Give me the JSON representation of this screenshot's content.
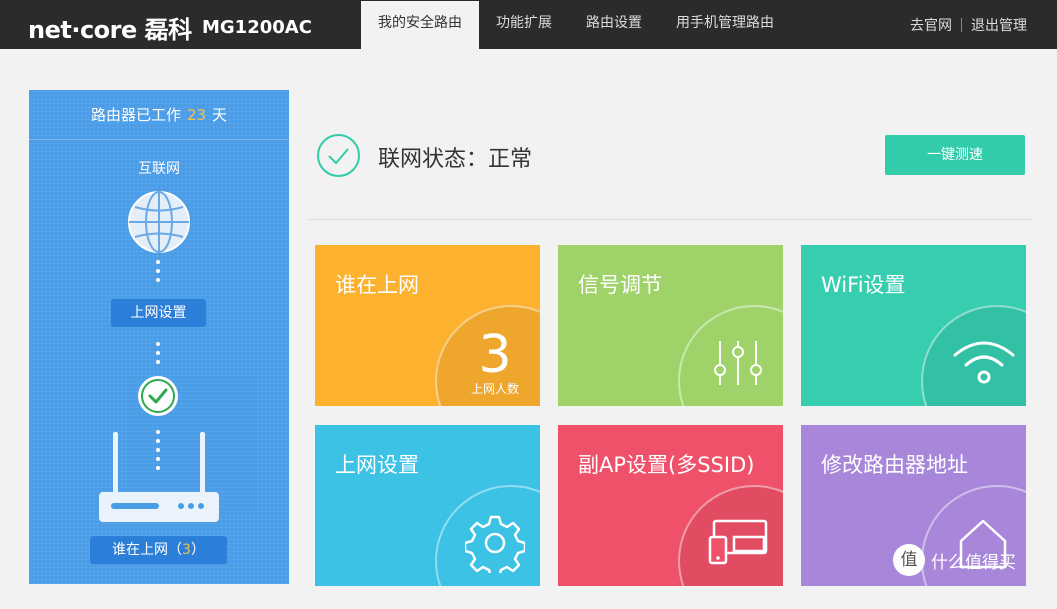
{
  "header": {
    "brand": "net·core 磊科",
    "model": "MG1200AC",
    "nav": [
      "我的安全路由",
      "功能扩展",
      "路由设置",
      "用手机管理路由"
    ],
    "links": [
      "去官网",
      "退出管理"
    ]
  },
  "sidebar": {
    "uptime_prefix": "路由器已工作",
    "uptime_days": "23",
    "uptime_suffix": "天",
    "internet_label": "互联网",
    "wan_button": "上网设置",
    "online_prefix": "谁在上网（",
    "online_count": "3",
    "online_suffix": "）"
  },
  "status": {
    "text": "联网状态：正常",
    "speed_test": "一键测速"
  },
  "tiles": [
    {
      "title": "谁在上网",
      "value": "3",
      "subtitle": "上网人数",
      "color": "#fdb22f",
      "icon": "count"
    },
    {
      "title": "信号调节",
      "color": "#9fd36a",
      "icon": "sliders-icon"
    },
    {
      "title": "WiFi设置",
      "color": "#37ceb0",
      "icon": "wifi-icon"
    },
    {
      "title": "上网设置",
      "color": "#3bc2e5",
      "icon": "gear-icon"
    },
    {
      "title": "副AP设置(多SSID)",
      "color": "#f0516a",
      "icon": "devices-icon"
    },
    {
      "title": "修改路由器地址",
      "color": "#a887db",
      "icon": "home-icon"
    }
  ],
  "watermark": {
    "badge": "值",
    "text": "什么值得买"
  }
}
